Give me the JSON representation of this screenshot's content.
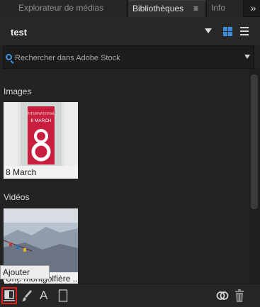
{
  "tabs": [
    {
      "label": "Explorateur de médias"
    },
    {
      "label": "Bibliothèques",
      "menu": "≡"
    },
    {
      "label": "Info"
    }
  ],
  "more_icon": "»",
  "library": {
    "name": "test"
  },
  "search": {
    "placeholder": "Rechercher dans Adobe Stock"
  },
  "sections": {
    "images": {
      "title": "Images",
      "items": [
        {
          "label": "8 March",
          "poster_title": "8 MARCH"
        }
      ]
    },
    "videos": {
      "title": "Vidéos",
      "items": [
        {
          "label": "Une montgolfière au-dessus d'un ciel clair",
          "visible_label": "Une montgolfière ..."
        }
      ]
    }
  },
  "tooltip": "Ajouter Look",
  "toolbar": {
    "icons": [
      "add-look-icon",
      "brush-icon",
      "text-icon",
      "color-swatch-icon",
      "creative-cloud-sync-icon",
      "trash-icon"
    ],
    "text_glyph": "A"
  },
  "colors": {
    "accent": "#3e8bd8",
    "highlight_border": "#e0201c",
    "panel_bg": "#232323"
  }
}
